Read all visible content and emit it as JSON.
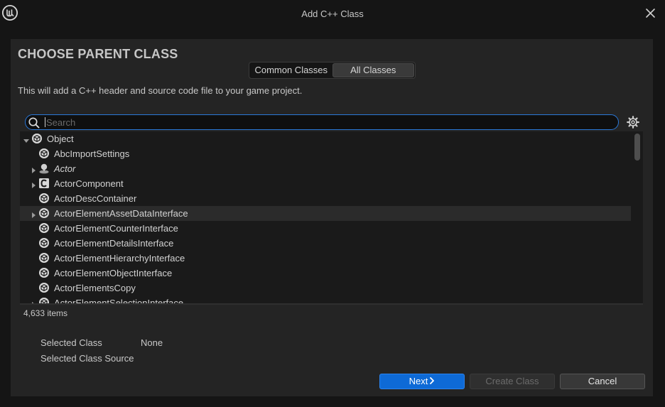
{
  "window": {
    "title": "Add C++ Class",
    "logo_icon": "unreal-logo-icon",
    "close_icon": "close-icon"
  },
  "heading": "CHOOSE PARENT CLASS",
  "tabs": [
    {
      "label": "Common Classes",
      "selected": false
    },
    {
      "label": "All Classes",
      "selected": true
    }
  ],
  "description": "This will add a C++ header and source code file to your game project.",
  "search": {
    "value": "",
    "placeholder": "Search",
    "icon": "search-icon"
  },
  "settings_icon": "gear-icon",
  "tree": {
    "items": [
      {
        "label": "Object",
        "icon": "object-class-icon",
        "expanded": true,
        "has_children": true,
        "depth": 0,
        "italic": false,
        "highlighted": false
      },
      {
        "label": "AbcImportSettings",
        "icon": "object-class-icon",
        "has_children": false,
        "depth": 1,
        "italic": false,
        "highlighted": false
      },
      {
        "label": "Actor",
        "icon": "actor-class-icon",
        "has_children": true,
        "depth": 1,
        "italic": true,
        "highlighted": false
      },
      {
        "label": "ActorComponent",
        "icon": "component-class-icon",
        "has_children": true,
        "depth": 1,
        "italic": false,
        "highlighted": false
      },
      {
        "label": "ActorDescContainer",
        "icon": "object-class-icon",
        "has_children": false,
        "depth": 1,
        "italic": false,
        "highlighted": false
      },
      {
        "label": "ActorElementAssetDataInterface",
        "icon": "object-class-icon",
        "has_children": true,
        "depth": 1,
        "italic": false,
        "highlighted": true
      },
      {
        "label": "ActorElementCounterInterface",
        "icon": "object-class-icon",
        "has_children": false,
        "depth": 1,
        "italic": false,
        "highlighted": false
      },
      {
        "label": "ActorElementDetailsInterface",
        "icon": "object-class-icon",
        "has_children": false,
        "depth": 1,
        "italic": false,
        "highlighted": false
      },
      {
        "label": "ActorElementHierarchyInterface",
        "icon": "object-class-icon",
        "has_children": false,
        "depth": 1,
        "italic": false,
        "highlighted": false
      },
      {
        "label": "ActorElementObjectInterface",
        "icon": "object-class-icon",
        "has_children": false,
        "depth": 1,
        "italic": false,
        "highlighted": false
      },
      {
        "label": "ActorElementsCopy",
        "icon": "object-class-icon",
        "has_children": false,
        "depth": 1,
        "italic": false,
        "highlighted": false
      },
      {
        "label": "ActorElementSelectionInterface",
        "icon": "object-class-icon",
        "has_children": true,
        "depth": 1,
        "italic": false,
        "highlighted": false
      }
    ]
  },
  "item_count": "4,633 items",
  "selected_class": {
    "label": "Selected Class",
    "value": "None"
  },
  "selected_class_source": {
    "label": "Selected Class Source",
    "value": ""
  },
  "buttons": {
    "next": "Next",
    "next_icon": "chevron-right-icon",
    "create": "Create Class",
    "cancel": "Cancel"
  },
  "colors": {
    "accent": "#0e6ad6",
    "search_focus": "#2a78d8"
  }
}
